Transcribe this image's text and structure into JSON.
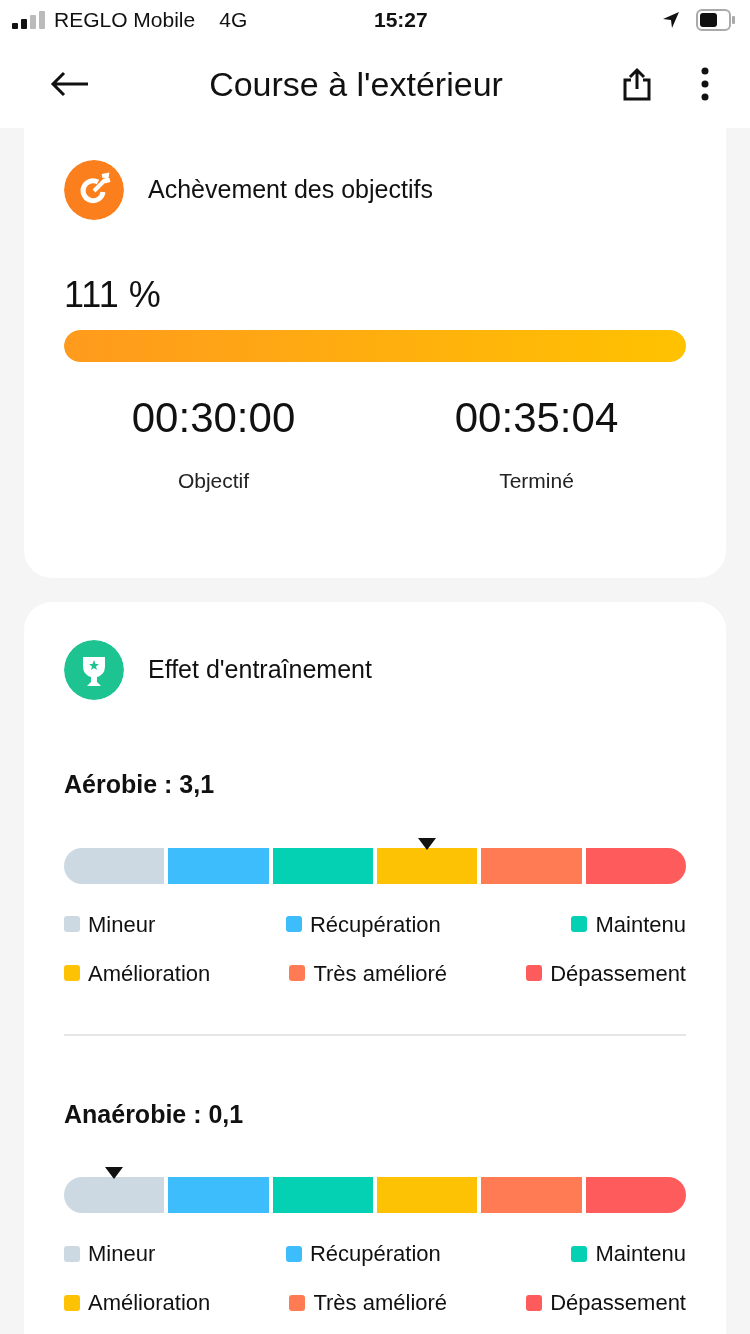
{
  "status_bar": {
    "carrier": "REGLO Mobile",
    "network": "4G",
    "time": "15:27"
  },
  "header": {
    "title": "Course à l'extérieur"
  },
  "goal_card": {
    "title": "Achèvement des objectifs",
    "percent": "111 %",
    "level": 1,
    "stats": [
      {
        "value": "00:30:00",
        "label": "Objectif"
      },
      {
        "value": "00:35:04",
        "label": "Terminé"
      }
    ]
  },
  "training_card": {
    "title": "Effet d'entraînement",
    "effects": [
      {
        "label": "Aérobie : 3,1",
        "legend": [
          {
            "label": "Mineur",
            "color": "#cdd9e2",
            "selected": false
          },
          {
            "label": "Récupération",
            "color": "#3dbdfb",
            "selected": false
          },
          {
            "label": "Maintenu",
            "color": "#04d0b4",
            "selected": false
          },
          {
            "label": "Amélioration",
            "color": "#fdc203",
            "selected": true
          },
          {
            "label": "Très amélioré",
            "color": "#fe7b54",
            "selected": false
          },
          {
            "label": "Dépassement",
            "color": "#fe5c5c",
            "selected": false
          }
        ]
      },
      {
        "label": "Anaérobie : 0,1",
        "legend": [
          {
            "label": "Mineur",
            "color": "#cdd9e2",
            "selected": true
          },
          {
            "label": "Récupération",
            "color": "#3dbdfb",
            "selected": false
          },
          {
            "label": "Maintenu",
            "color": "#04d0b4",
            "selected": false
          },
          {
            "label": "Amélioration",
            "color": "#fdc203",
            "selected": false
          },
          {
            "label": "Très amélioré",
            "color": "#fe7b54",
            "selected": false
          },
          {
            "label": "Dépassement",
            "color": "#fe5c5c",
            "selected": false
          }
        ]
      }
    ]
  }
}
